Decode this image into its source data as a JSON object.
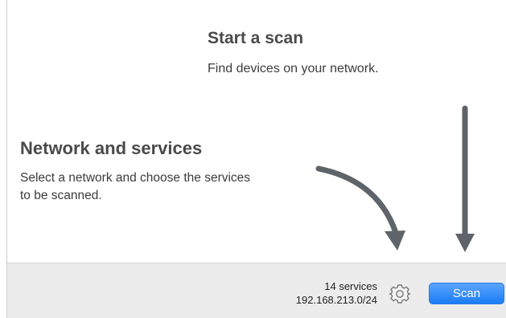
{
  "start": {
    "title": "Start a scan",
    "subtitle": "Find devices on your network."
  },
  "network": {
    "title": "Network and services",
    "description": "Select a network and choose the services to be scanned."
  },
  "bottom_bar": {
    "services_count": "14 services",
    "network_range": "192.168.213.0/24",
    "settings_icon": "gear-icon",
    "scan_label": "Scan"
  },
  "colors": {
    "arrow": "#5e6469",
    "scan_button": "#1a7cf4",
    "bar_background": "#ececec"
  }
}
